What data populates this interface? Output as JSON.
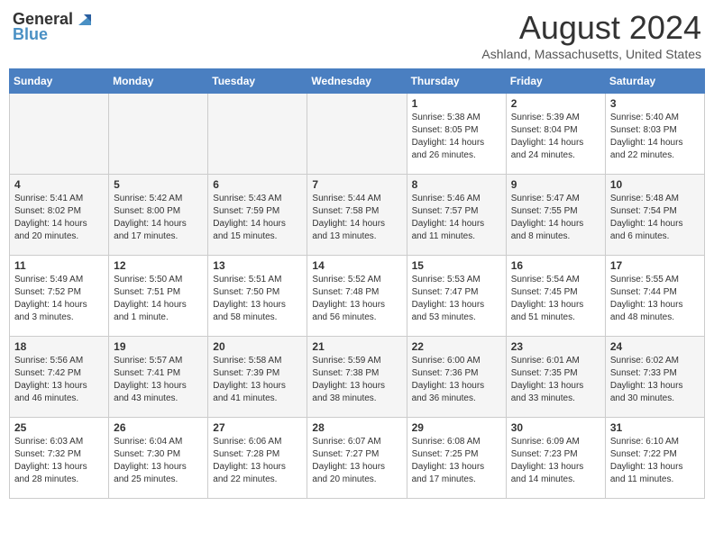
{
  "header": {
    "logo_general": "General",
    "logo_blue": "Blue",
    "month": "August 2024",
    "location": "Ashland, Massachusetts, United States"
  },
  "weekdays": [
    "Sunday",
    "Monday",
    "Tuesday",
    "Wednesday",
    "Thursday",
    "Friday",
    "Saturday"
  ],
  "weeks": [
    [
      {
        "day": "",
        "info": ""
      },
      {
        "day": "",
        "info": ""
      },
      {
        "day": "",
        "info": ""
      },
      {
        "day": "",
        "info": ""
      },
      {
        "day": "1",
        "info": "Sunrise: 5:38 AM\nSunset: 8:05 PM\nDaylight: 14 hours\nand 26 minutes."
      },
      {
        "day": "2",
        "info": "Sunrise: 5:39 AM\nSunset: 8:04 PM\nDaylight: 14 hours\nand 24 minutes."
      },
      {
        "day": "3",
        "info": "Sunrise: 5:40 AM\nSunset: 8:03 PM\nDaylight: 14 hours\nand 22 minutes."
      }
    ],
    [
      {
        "day": "4",
        "info": "Sunrise: 5:41 AM\nSunset: 8:02 PM\nDaylight: 14 hours\nand 20 minutes."
      },
      {
        "day": "5",
        "info": "Sunrise: 5:42 AM\nSunset: 8:00 PM\nDaylight: 14 hours\nand 17 minutes."
      },
      {
        "day": "6",
        "info": "Sunrise: 5:43 AM\nSunset: 7:59 PM\nDaylight: 14 hours\nand 15 minutes."
      },
      {
        "day": "7",
        "info": "Sunrise: 5:44 AM\nSunset: 7:58 PM\nDaylight: 14 hours\nand 13 minutes."
      },
      {
        "day": "8",
        "info": "Sunrise: 5:46 AM\nSunset: 7:57 PM\nDaylight: 14 hours\nand 11 minutes."
      },
      {
        "day": "9",
        "info": "Sunrise: 5:47 AM\nSunset: 7:55 PM\nDaylight: 14 hours\nand 8 minutes."
      },
      {
        "day": "10",
        "info": "Sunrise: 5:48 AM\nSunset: 7:54 PM\nDaylight: 14 hours\nand 6 minutes."
      }
    ],
    [
      {
        "day": "11",
        "info": "Sunrise: 5:49 AM\nSunset: 7:52 PM\nDaylight: 14 hours\nand 3 minutes."
      },
      {
        "day": "12",
        "info": "Sunrise: 5:50 AM\nSunset: 7:51 PM\nDaylight: 14 hours\nand 1 minute."
      },
      {
        "day": "13",
        "info": "Sunrise: 5:51 AM\nSunset: 7:50 PM\nDaylight: 13 hours\nand 58 minutes."
      },
      {
        "day": "14",
        "info": "Sunrise: 5:52 AM\nSunset: 7:48 PM\nDaylight: 13 hours\nand 56 minutes."
      },
      {
        "day": "15",
        "info": "Sunrise: 5:53 AM\nSunset: 7:47 PM\nDaylight: 13 hours\nand 53 minutes."
      },
      {
        "day": "16",
        "info": "Sunrise: 5:54 AM\nSunset: 7:45 PM\nDaylight: 13 hours\nand 51 minutes."
      },
      {
        "day": "17",
        "info": "Sunrise: 5:55 AM\nSunset: 7:44 PM\nDaylight: 13 hours\nand 48 minutes."
      }
    ],
    [
      {
        "day": "18",
        "info": "Sunrise: 5:56 AM\nSunset: 7:42 PM\nDaylight: 13 hours\nand 46 minutes."
      },
      {
        "day": "19",
        "info": "Sunrise: 5:57 AM\nSunset: 7:41 PM\nDaylight: 13 hours\nand 43 minutes."
      },
      {
        "day": "20",
        "info": "Sunrise: 5:58 AM\nSunset: 7:39 PM\nDaylight: 13 hours\nand 41 minutes."
      },
      {
        "day": "21",
        "info": "Sunrise: 5:59 AM\nSunset: 7:38 PM\nDaylight: 13 hours\nand 38 minutes."
      },
      {
        "day": "22",
        "info": "Sunrise: 6:00 AM\nSunset: 7:36 PM\nDaylight: 13 hours\nand 36 minutes."
      },
      {
        "day": "23",
        "info": "Sunrise: 6:01 AM\nSunset: 7:35 PM\nDaylight: 13 hours\nand 33 minutes."
      },
      {
        "day": "24",
        "info": "Sunrise: 6:02 AM\nSunset: 7:33 PM\nDaylight: 13 hours\nand 30 minutes."
      }
    ],
    [
      {
        "day": "25",
        "info": "Sunrise: 6:03 AM\nSunset: 7:32 PM\nDaylight: 13 hours\nand 28 minutes."
      },
      {
        "day": "26",
        "info": "Sunrise: 6:04 AM\nSunset: 7:30 PM\nDaylight: 13 hours\nand 25 minutes."
      },
      {
        "day": "27",
        "info": "Sunrise: 6:06 AM\nSunset: 7:28 PM\nDaylight: 13 hours\nand 22 minutes."
      },
      {
        "day": "28",
        "info": "Sunrise: 6:07 AM\nSunset: 7:27 PM\nDaylight: 13 hours\nand 20 minutes."
      },
      {
        "day": "29",
        "info": "Sunrise: 6:08 AM\nSunset: 7:25 PM\nDaylight: 13 hours\nand 17 minutes."
      },
      {
        "day": "30",
        "info": "Sunrise: 6:09 AM\nSunset: 7:23 PM\nDaylight: 13 hours\nand 14 minutes."
      },
      {
        "day": "31",
        "info": "Sunrise: 6:10 AM\nSunset: 7:22 PM\nDaylight: 13 hours\nand 11 minutes."
      }
    ]
  ]
}
